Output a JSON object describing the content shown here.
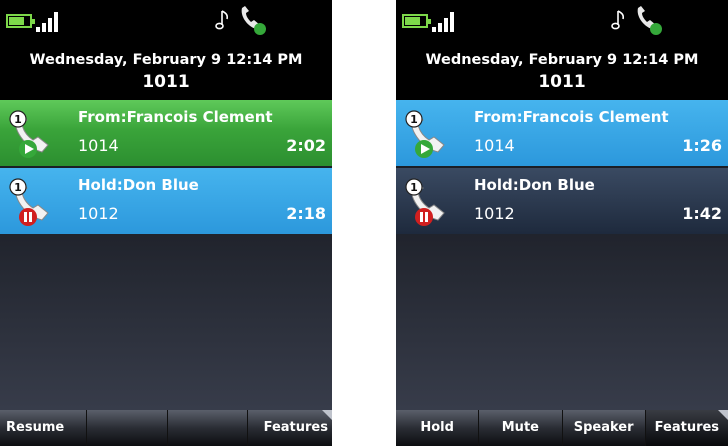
{
  "phones": [
    {
      "date": "Wednesday, February 9 12:14 PM",
      "extension": "1011",
      "calls": [
        {
          "name": "From:Francois Clement",
          "number": "1014",
          "timer": "2:02",
          "line": "1",
          "state": "active",
          "color": "green"
        },
        {
          "name": "Hold:Don Blue",
          "number": "1012",
          "timer": "2:18",
          "line": "1",
          "state": "hold",
          "color": "blue"
        }
      ],
      "softkeys": [
        "Resume",
        "",
        "",
        "Features"
      ]
    },
    {
      "date": "Wednesday, February 9 12:14 PM",
      "extension": "1011",
      "calls": [
        {
          "name": "From:Francois Clement",
          "number": "1014",
          "timer": "1:26",
          "line": "1",
          "state": "active",
          "color": "blue"
        },
        {
          "name": "Hold:Don Blue",
          "number": "1012",
          "timer": "1:42",
          "line": "1",
          "state": "hold",
          "color": "dark"
        }
      ],
      "softkeys": [
        "Hold",
        "Mute",
        "Speaker",
        "Features"
      ]
    }
  ],
  "icons": {
    "battery": "battery-icon",
    "signal": "signal-strength-icon",
    "music": "music-note-icon",
    "handset": "handset-status-icon",
    "active_call": "active-call-handset-icon",
    "held_call": "held-call-handset-icon"
  },
  "colors": {
    "active_green": "#3aa43a",
    "highlight_blue": "#2c98dc",
    "held_dark": "#1e2a3d",
    "battery_green": "#7dd84a",
    "play_green": "#35a83a",
    "hold_red": "#d11f1f"
  }
}
